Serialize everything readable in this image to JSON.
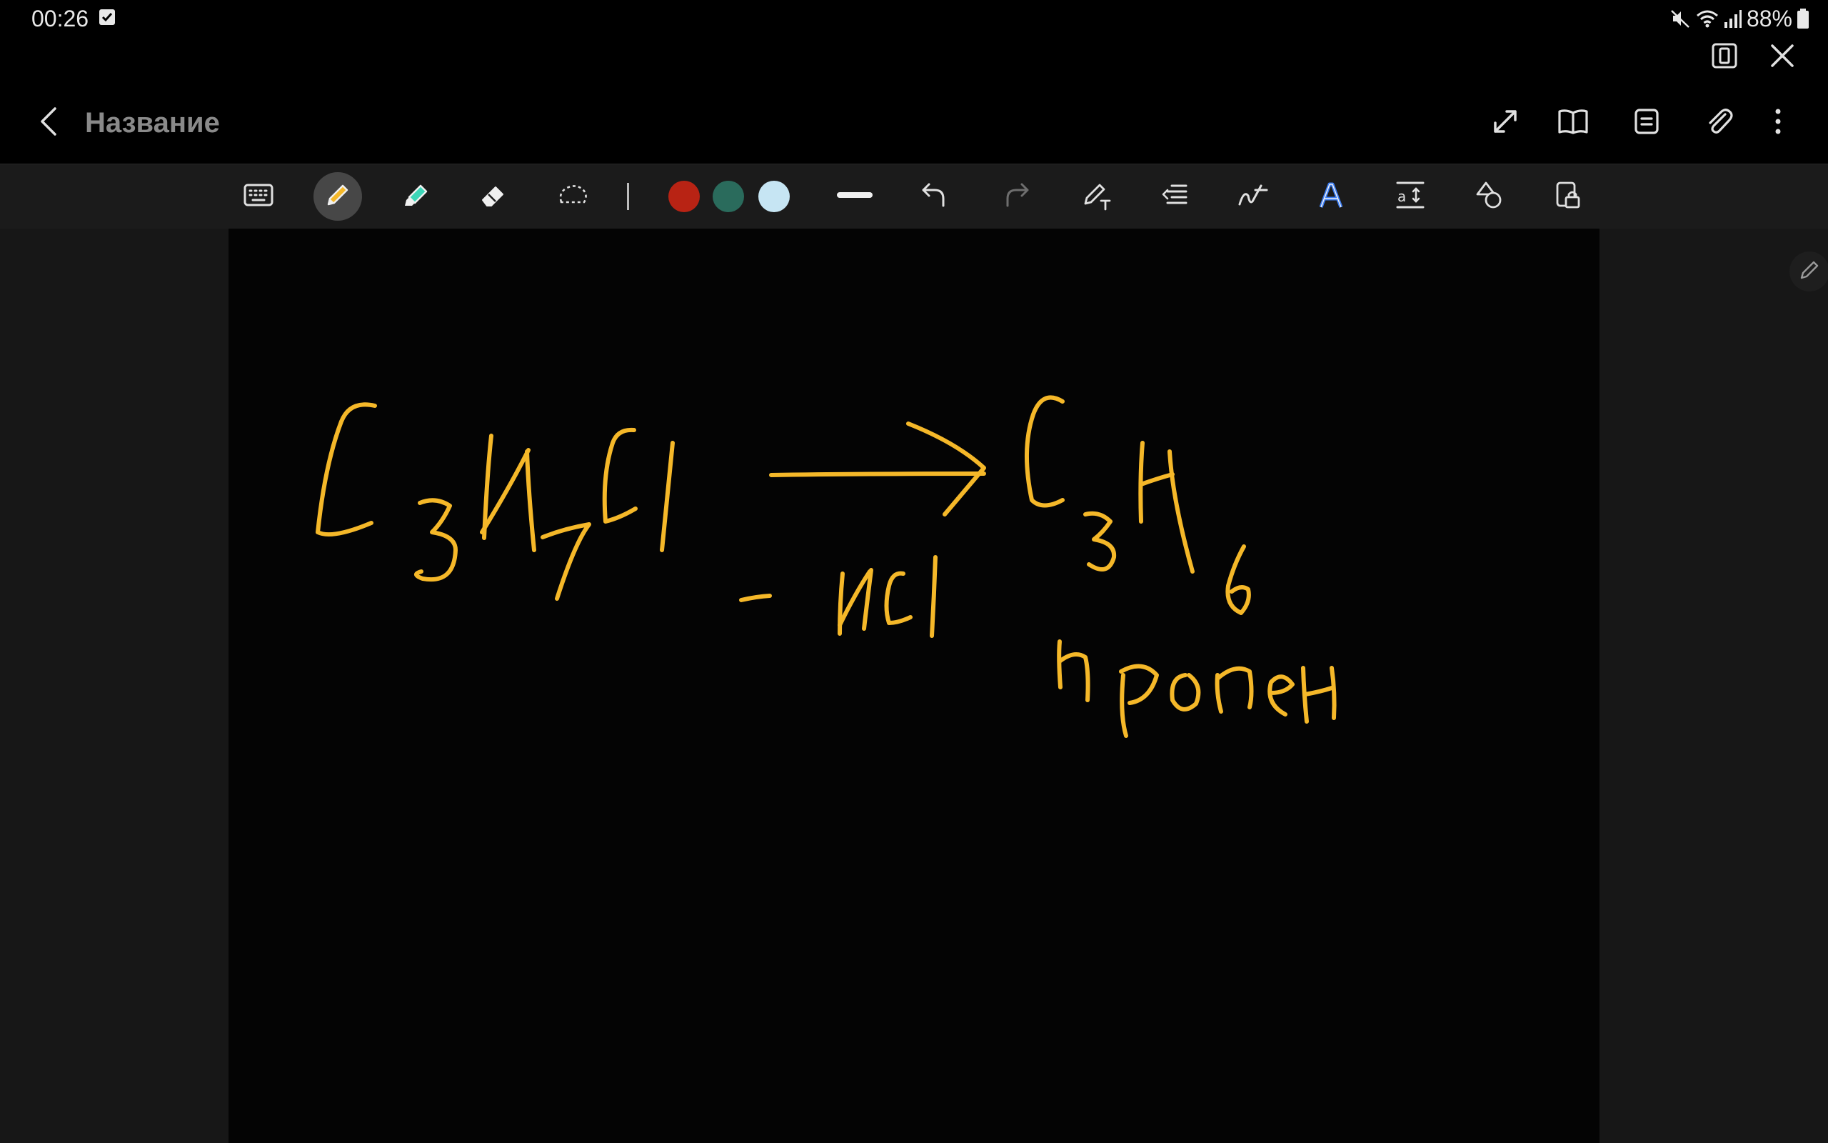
{
  "status_bar": {
    "time": "00:26",
    "battery": "88%",
    "icons": [
      "check-notification-icon",
      "mute-icon",
      "wifi-icon",
      "signal-icon",
      "battery-icon"
    ]
  },
  "window_controls": [
    "multi-window-icon",
    "close-icon"
  ],
  "header": {
    "title": "Название",
    "actions": [
      "expand-icon",
      "book-view-icon",
      "page-settings-icon",
      "attachment-icon",
      "more-options-icon"
    ]
  },
  "toolbar": {
    "tools": [
      "keyboard-icon",
      "pen-icon",
      "highlighter-icon",
      "eraser-icon",
      "lasso-select-icon"
    ],
    "active_tool": "pen",
    "colors": [
      "#b82314",
      "#2a6b5c",
      "#c6e5f3"
    ],
    "actions": [
      "stroke-width-icon",
      "undo-icon",
      "redo-icon",
      "pen-to-text-icon",
      "text-format-icon",
      "handwriting-icon",
      "text-style-icon",
      "text-spacing-icon",
      "shapes-icon",
      "lock-icon"
    ]
  },
  "ink_color": "#f5b829",
  "handwriting": {
    "line1": "C3H7Cl → C3H6",
    "line2": "– HCl",
    "line3": "пропен"
  }
}
